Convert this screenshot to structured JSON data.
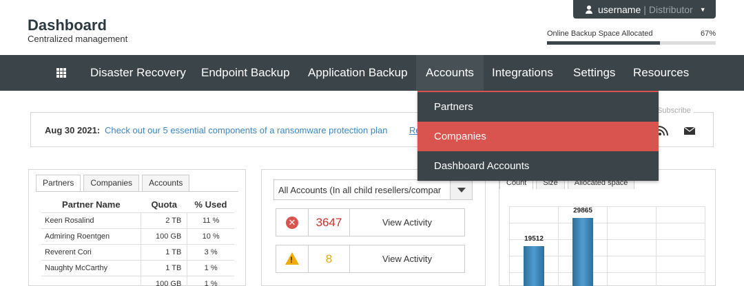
{
  "header": {
    "title": "Dashboard",
    "subtitle": "Centralized management",
    "user": {
      "name": "username",
      "role": "Distributor"
    },
    "backup": {
      "label": "Online Backup Space Allocated",
      "percent_text": "67%",
      "percent": 67
    }
  },
  "nav": {
    "items": [
      {
        "label": "Disaster Recovery"
      },
      {
        "label": "Endpoint Backup"
      },
      {
        "label": "Application Backup"
      },
      {
        "label": "Accounts",
        "active": true
      },
      {
        "label": "Integrations"
      },
      {
        "label": "Settings"
      },
      {
        "label": "Resources"
      }
    ],
    "accounts_menu": [
      {
        "label": "Partners"
      },
      {
        "label": "Companies",
        "active": true
      },
      {
        "label": "Dashboard Accounts"
      }
    ]
  },
  "announcement": {
    "date": "Aug 30 2021:",
    "message": "Check out our 5 essential components of a ransomware protection plan",
    "more": "Re",
    "subscribe": "Subscribe"
  },
  "partners_panel": {
    "tabs": [
      "Partners",
      "Companies",
      "Accounts"
    ],
    "columns": [
      "Partner Name",
      "Quota",
      "% Used"
    ],
    "rows": [
      [
        "Keen Rosalind",
        "2 TB",
        "11 %"
      ],
      [
        "Admiring Roentgen",
        "100 GB",
        "10 %"
      ],
      [
        "Reverent Cori",
        "1 TB",
        "3 %"
      ],
      [
        "Naughty McCarthy",
        "1 TB",
        "1 %"
      ],
      [
        "",
        "100 GB",
        "1 %"
      ]
    ]
  },
  "activity_panel": {
    "filter": "All Accounts (In all child resellers/compar",
    "cards": [
      {
        "count": "3647",
        "action": "View Activity",
        "icon": "error-icon",
        "color": "#c9302c"
      },
      {
        "count": "8",
        "action": "View Activity",
        "icon": "warning-icon",
        "color": "#e0a800"
      }
    ]
  },
  "chart_panel": {
    "tabs": [
      "Count",
      "Size",
      "Allocated space"
    ]
  },
  "chart_data": {
    "type": "bar",
    "categories": [
      "",
      ""
    ],
    "values": [
      19512,
      29865
    ],
    "ylim": [
      0,
      36000
    ],
    "grid": true
  }
}
